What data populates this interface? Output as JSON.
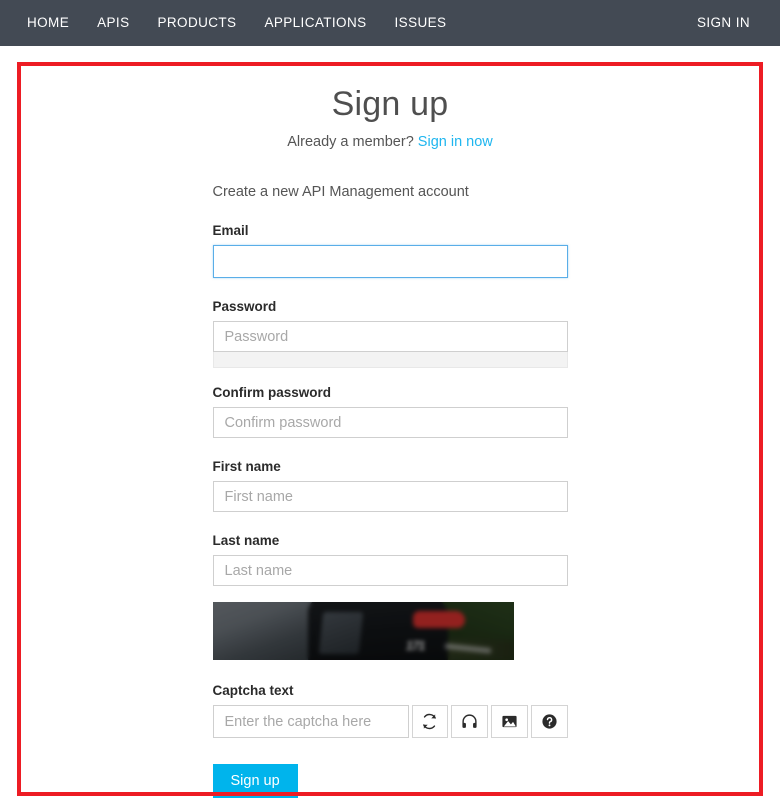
{
  "navbar": {
    "items": [
      {
        "label": "HOME",
        "name": "nav-item-home"
      },
      {
        "label": "APIS",
        "name": "nav-item-apis"
      },
      {
        "label": "PRODUCTS",
        "name": "nav-item-products"
      },
      {
        "label": "APPLICATIONS",
        "name": "nav-item-applications"
      },
      {
        "label": "ISSUES",
        "name": "nav-item-issues"
      }
    ],
    "signin_label": "SIGN IN",
    "background_color": "#434a54"
  },
  "page": {
    "title": "Sign up",
    "subtitle_prefix": "Already a member?",
    "subtitle_link": "Sign in now",
    "link_color": "#1fb6ef"
  },
  "form": {
    "intro": "Create a new API Management account",
    "fields": [
      {
        "label": "Email",
        "placeholder": "",
        "value": ""
      },
      {
        "label": "Password",
        "placeholder": "Password",
        "value": ""
      },
      {
        "label": "Confirm password",
        "placeholder": "Confirm password",
        "value": ""
      },
      {
        "label": "First name",
        "placeholder": "First name",
        "value": ""
      },
      {
        "label": "Last name",
        "placeholder": "Last name",
        "value": ""
      }
    ],
    "captcha_label": "Captcha text",
    "captcha_placeholder": "Enter the captcha here",
    "captcha_value": "",
    "captcha_image_text": "171",
    "captcha_buttons": [
      {
        "name": "refresh-icon",
        "title": "Refresh captcha"
      },
      {
        "name": "headphones-icon",
        "title": "Audio captcha"
      },
      {
        "name": "image-icon",
        "title": "Image captcha"
      },
      {
        "name": "help-icon",
        "title": "Help"
      }
    ],
    "submit_label": "Sign up",
    "submit_color": "#00b4ec"
  },
  "annotation": {
    "border_color": "#ed1c24"
  }
}
